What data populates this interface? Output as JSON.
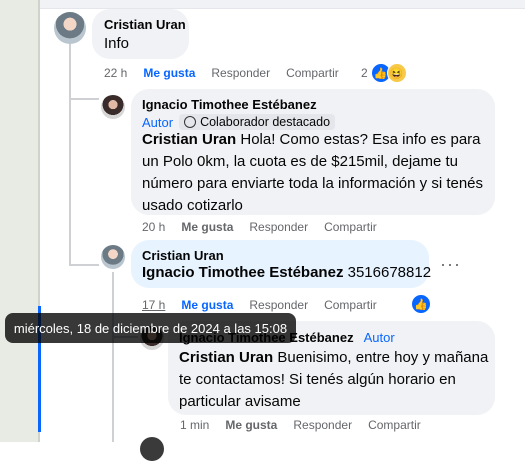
{
  "comment_1": {
    "author": "Cristian Uran",
    "text": "Info",
    "time": "22 h",
    "like": "Me gusta",
    "reply": "Responder",
    "share": "Compartir",
    "reaction_count": "2"
  },
  "reply_1": {
    "author": "Ignacio Timothee Estébanez",
    "role": "Autor",
    "badge": "Colaborador destacado",
    "mention": "Cristian Uran",
    "text": " Hola! Como estas? Esa info es para un Polo 0km, la cuota es de $215mil, dejame tu número para enviarte toda la información y si tenés usado cotizarlo",
    "time": "20 h",
    "like": "Me gusta",
    "reply": "Responder",
    "share": "Compartir"
  },
  "reply_2": {
    "author": "Cristian Uran",
    "mention": "Ignacio Timothee Estébanez",
    "text": " 3516678812",
    "time": "17 h",
    "like": "Me gusta",
    "reply": "Responder",
    "share": "Compartir"
  },
  "reply_3": {
    "author": "Ignacio Timothee Estébanez",
    "role": "Autor",
    "mention": "Cristian Uran",
    "text": " Buenisimo, entre hoy y mañana te contactamos! Si tenés algún horario en particular avisame",
    "time": "1 min",
    "like": "Me gusta",
    "reply": "Responder",
    "share": "Compartir"
  },
  "tooltip": "miércoles, 18 de diciembre de 2024 a las 15:08",
  "colors": {
    "accent": "#0866ff",
    "bubble": "#f0f2f5",
    "selected_bubble": "#e7f3ff"
  }
}
